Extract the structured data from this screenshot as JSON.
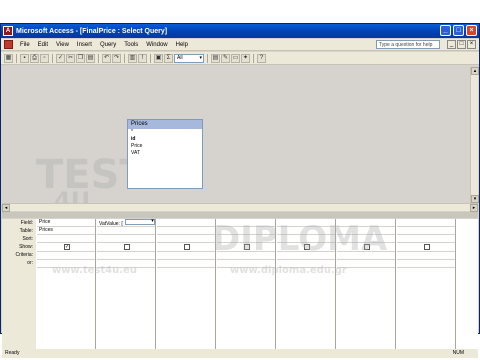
{
  "window": {
    "title": "Microsoft Access - [FinalPrice : Select Query]"
  },
  "menu": [
    "File",
    "Edit",
    "View",
    "Insert",
    "Query",
    "Tools",
    "Window",
    "Help"
  ],
  "help": {
    "placeholder": "Type a question for help"
  },
  "toolbar": {
    "view_combo": "All"
  },
  "table": {
    "name": "Prices",
    "fields": [
      "*",
      "id",
      "Price",
      "VAT"
    ]
  },
  "grid": {
    "row_labels": [
      "Field:",
      "Table:",
      "Sort:",
      "Show:",
      "Criteria:",
      "or:"
    ],
    "columns": [
      {
        "field": "Price",
        "table": "Prices",
        "show": true
      },
      {
        "field": "VatValue: [",
        "table": "",
        "show": false
      },
      {
        "field": "",
        "table": "",
        "show": false
      },
      {
        "field": "",
        "table": "",
        "show": false
      },
      {
        "field": "",
        "table": "",
        "show": false
      },
      {
        "field": "",
        "table": "",
        "show": false
      },
      {
        "field": "",
        "table": "",
        "show": false
      }
    ]
  },
  "status": {
    "text": "Ready",
    "num": "NUM"
  },
  "watermarks": [
    "TEST",
    "4U",
    "DIPLOMA",
    "www.test4u.eu",
    "www.diploma.edu.gr"
  ],
  "colors": {
    "titlebar": "#0040b0",
    "table_header": "#a6b8dc"
  }
}
